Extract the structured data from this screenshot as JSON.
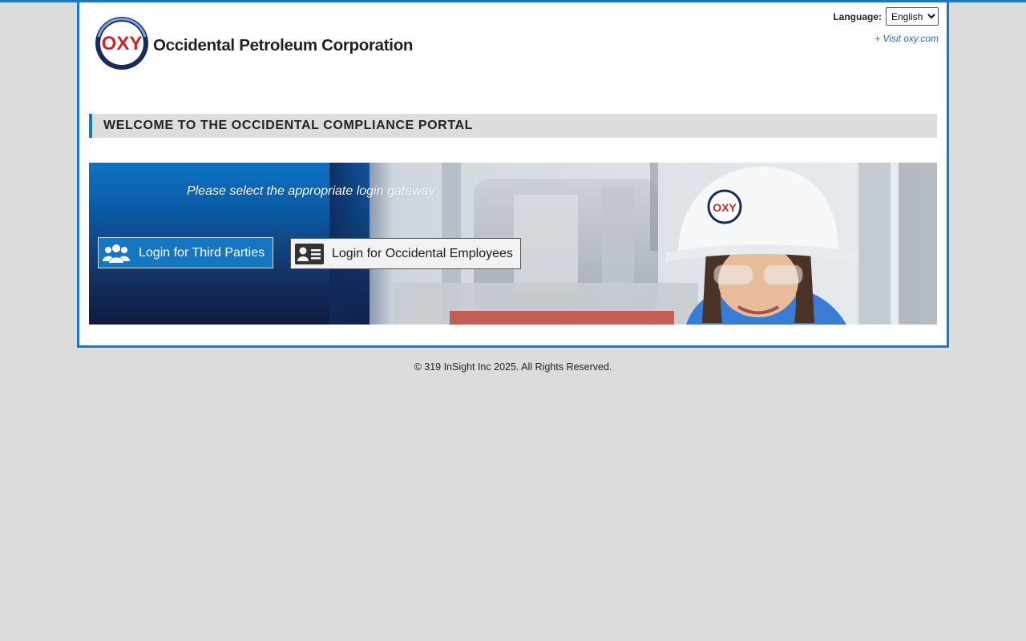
{
  "header": {
    "logo_word": "OXY",
    "company_name": "Occidental Petroleum Corporation",
    "language_label": "Language:",
    "language_selected": "English",
    "visit_link": "+ Visit oxy.com"
  },
  "welcome": {
    "title": "WELCOME TO THE OCCIDENTAL COMPLIANCE PORTAL"
  },
  "banner": {
    "prompt": "Please select the appropriate login gateway",
    "hat_logo": "OXY",
    "buttons": {
      "third_parties": "Login for Third Parties",
      "employees": "Login for Occidental Employees"
    }
  },
  "footer": {
    "copyright": "© 319 InSight Inc 2025. All Rights Reserved."
  },
  "colors": {
    "accent": "#1c77c3",
    "logo_red": "#d2232a",
    "logo_navy": "#1b2a5c"
  },
  "icons": [
    "group-icon",
    "employee-id-card-icon",
    "chevron-down-icon"
  ]
}
